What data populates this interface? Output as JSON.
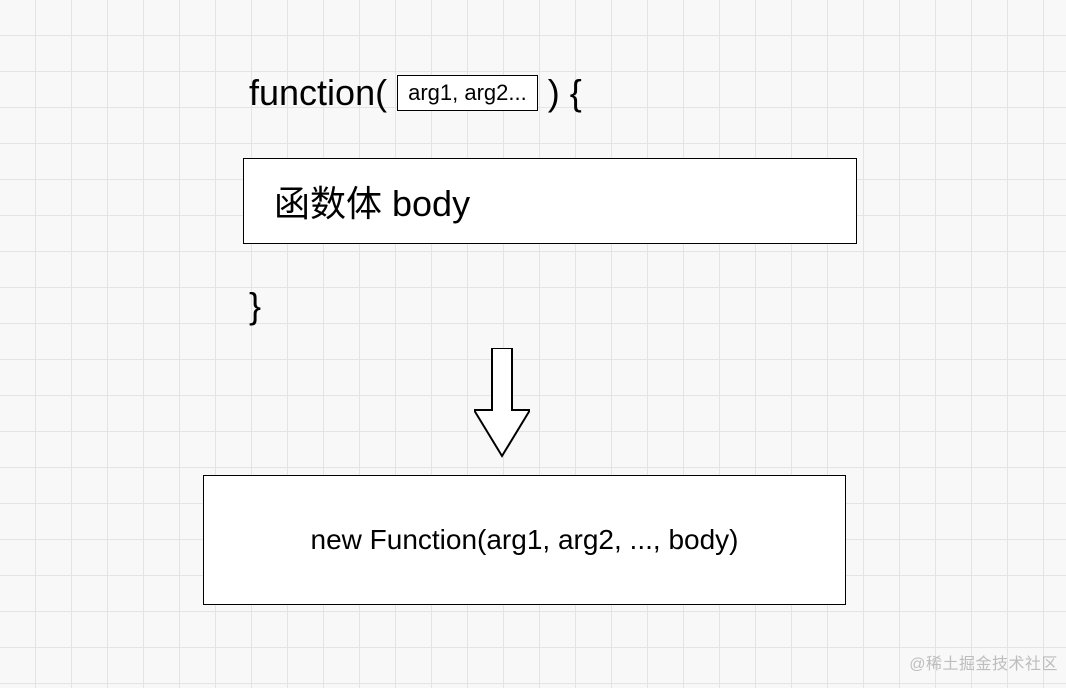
{
  "func": {
    "keyword_open": "function(",
    "args_placeholder": "arg1, arg2...",
    "keyword_close": ") {"
  },
  "body_box": {
    "label": "函数体 body"
  },
  "close_brace": "}",
  "result_box": {
    "label": "new Function(arg1, arg2, ..., body)"
  },
  "watermark": "@稀土掘金技术社区"
}
